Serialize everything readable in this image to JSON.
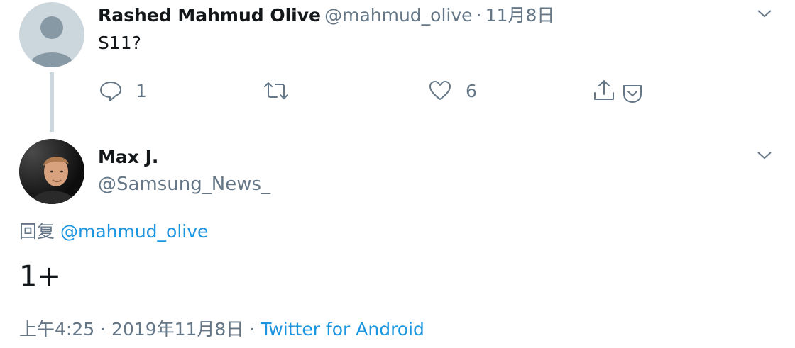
{
  "parent_tweet": {
    "name": "Rashed Mahmud Olive",
    "handle": "@mahmud_olive",
    "separator": "·",
    "date": "11月8日",
    "text": "S11?",
    "reply_count": "1",
    "like_count": "6",
    "icons": {
      "reply": "reply-icon",
      "retweet": "retweet-icon",
      "like": "heart-icon",
      "share": "share-icon",
      "extra": "chevron-down-badge-icon",
      "menu": "chevron-down-icon"
    }
  },
  "main_tweet": {
    "name": "Max J.",
    "handle": "@Samsung_News_",
    "reply_prefix": "回复",
    "reply_to": "@mahmud_olive",
    "text": "1+",
    "time": "上午4:25",
    "separator1": "·",
    "date": "2019年11月8日",
    "separator2": "·",
    "source": "Twitter for Android"
  },
  "colors": {
    "link": "#1b95e0",
    "secondary_text": "#657786",
    "primary_text": "#14171a",
    "thread_line": "#ccd6dd"
  }
}
